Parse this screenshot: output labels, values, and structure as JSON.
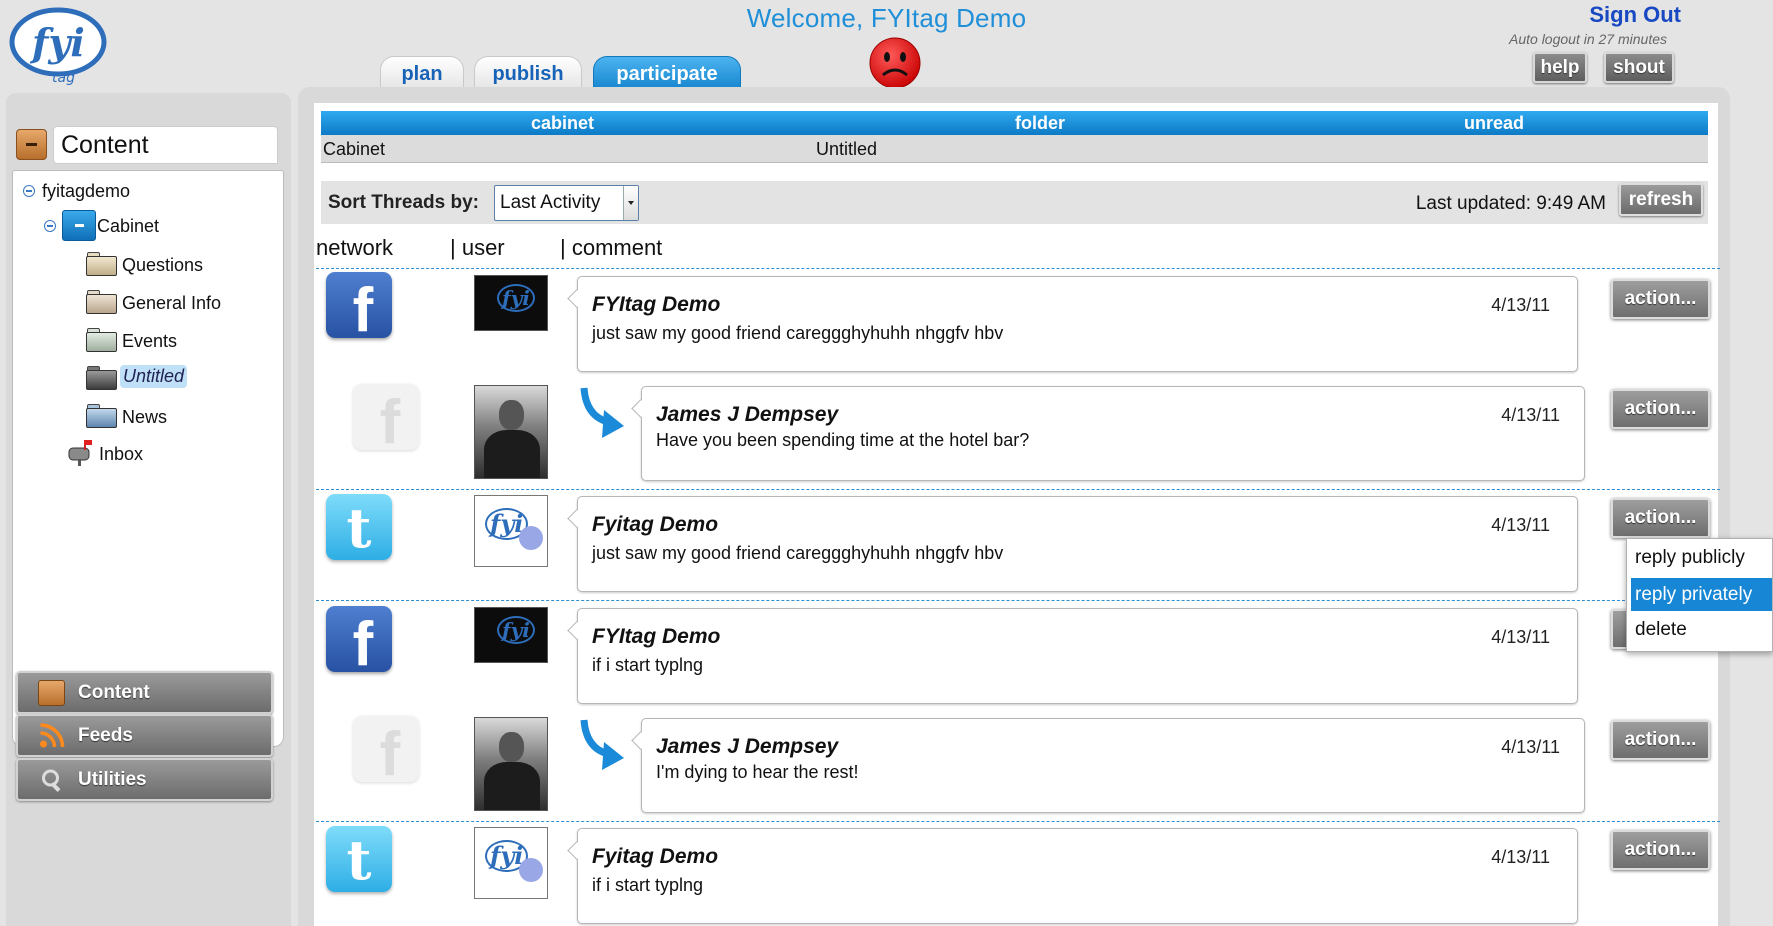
{
  "header": {
    "welcome": "Welcome, FYItag Demo",
    "sign_out": "Sign Out",
    "auto_logout": "Auto logout in 27 minutes",
    "help_label": "help",
    "shout_label": "shout"
  },
  "tabs": [
    {
      "label": "plan",
      "active": false
    },
    {
      "label": "publish",
      "active": false
    },
    {
      "label": "participate",
      "active": true
    }
  ],
  "sidebar": {
    "section_title": "Content",
    "tree": {
      "root": "fyitagdemo",
      "cabinet": "Cabinet",
      "folders": [
        "Questions",
        "General Info",
        "Events",
        "Untitled",
        "News"
      ],
      "selected_folder": "Untitled",
      "inbox": "Inbox"
    },
    "bottom_buttons": [
      "Content",
      "Feeds",
      "Utilities"
    ]
  },
  "main": {
    "columns": {
      "cabinet": "cabinet",
      "folder": "folder",
      "unread": "unread"
    },
    "info": {
      "cabinet": "Cabinet",
      "folder": "Untitled",
      "unread": ""
    },
    "sort_label": "Sort Threads by:",
    "sort_value": "Last Activity",
    "last_updated": "Last updated: 9:49 AM",
    "refresh_label": "refresh",
    "list_headers": {
      "network": "network",
      "user": "| user",
      "comment": "| comment"
    },
    "action_label": "action...",
    "threads": [
      {
        "network": "facebook",
        "author": "FYItag Demo",
        "date": "4/13/11",
        "message": "just saw my good friend careggghyhuhh nhggfv hbv"
      },
      {
        "network": "facebook",
        "author": "James J Dempsey",
        "date": "4/13/11",
        "message": "Have you been spending time at the hotel bar?"
      },
      {
        "network": "twitter",
        "author": "Fyitag Demo",
        "date": "4/13/11",
        "message": "just saw my good friend careggghyhuhh nhggfv hbv"
      },
      {
        "network": "facebook",
        "author": "FYItag Demo",
        "date": "4/13/11",
        "message": "if i start typlng"
      },
      {
        "network": "facebook",
        "author": "James J Dempsey",
        "date": "4/13/11",
        "message": "I'm dying to hear the rest!"
      },
      {
        "network": "twitter",
        "author": "Fyitag Demo",
        "date": "4/13/11",
        "message": "if i start typlng"
      }
    ],
    "action_menu": [
      "reply publicly",
      "reply privately",
      "delete"
    ],
    "action_menu_highlighted": "reply privately"
  },
  "colors": {
    "accent_blue": "#1787d5",
    "welcome_blue": "#1f8fd8",
    "signout_blue": "#1848c2",
    "frown_red": "#e01010"
  }
}
